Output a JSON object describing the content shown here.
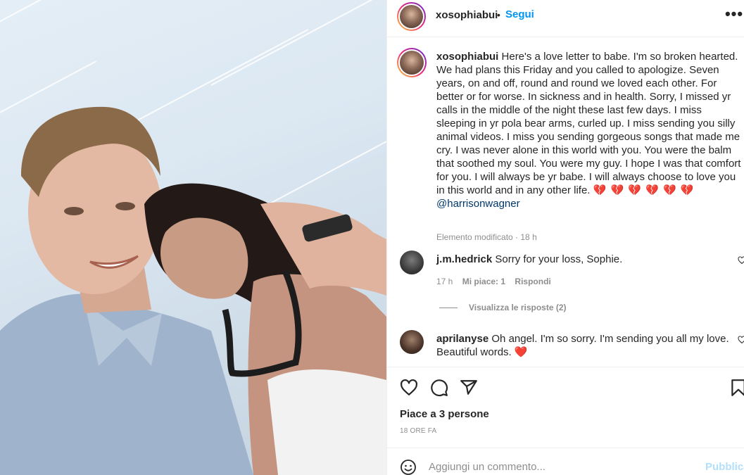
{
  "post": {
    "username": "xosophiabui",
    "dot": "•",
    "follow_label": "Segui",
    "more_label": "•••"
  },
  "caption": {
    "username": "xosophiabui",
    "text": "Here's a love letter to babe. I'm so broken hearted. We had plans this Friday and you called to apologize. Seven years, on and off, round and round we loved each other. For better or for worse. In sickness and in health. Sorry, I missed yr calls in the middle of the night these last few days. I miss sleeping in yr pola bear arms, curled up. I miss sending you silly animal videos. I miss you sending gorgeous songs that made me cry. I was never alone in this world with you. You were the balm that soothed my soul. You were my guy. I hope I was that comfort for you. I will always be yr babe. I will always choose to love you in this world and in any other life.",
    "hearts": "💔 💔 💔 💔 💔 💔",
    "mention": "@harrisonwagner",
    "meta": "Elemento modificato · 18 h"
  },
  "comments": [
    {
      "username": "j.m.hedrick",
      "text": "Sorry for your loss, Sophie.",
      "time": "17 h",
      "likes": "Mi piace: 1",
      "reply": "Rispondi"
    },
    {
      "username": "aprilanyse",
      "text": "Oh angel. I'm so sorry. I'm sending you all my love. Beautiful words.",
      "heart": "❤️"
    }
  ],
  "view_replies": "Visualizza le risposte (2)",
  "actions": {
    "likes_label": "Piace a 3 persone",
    "timestamp": "18 ORE FA",
    "icons": [
      "heart-icon",
      "comment-icon",
      "share-icon",
      "bookmark-icon"
    ]
  },
  "add_comment": {
    "placeholder": "Aggiungi un commento...",
    "post_label": "Pubblica"
  },
  "colors": {
    "link_blue": "#0095f6",
    "post_disabled": "#b2dffc",
    "muted": "#8e8e8e",
    "text": "#262626",
    "heart_red": "#ed4956"
  }
}
